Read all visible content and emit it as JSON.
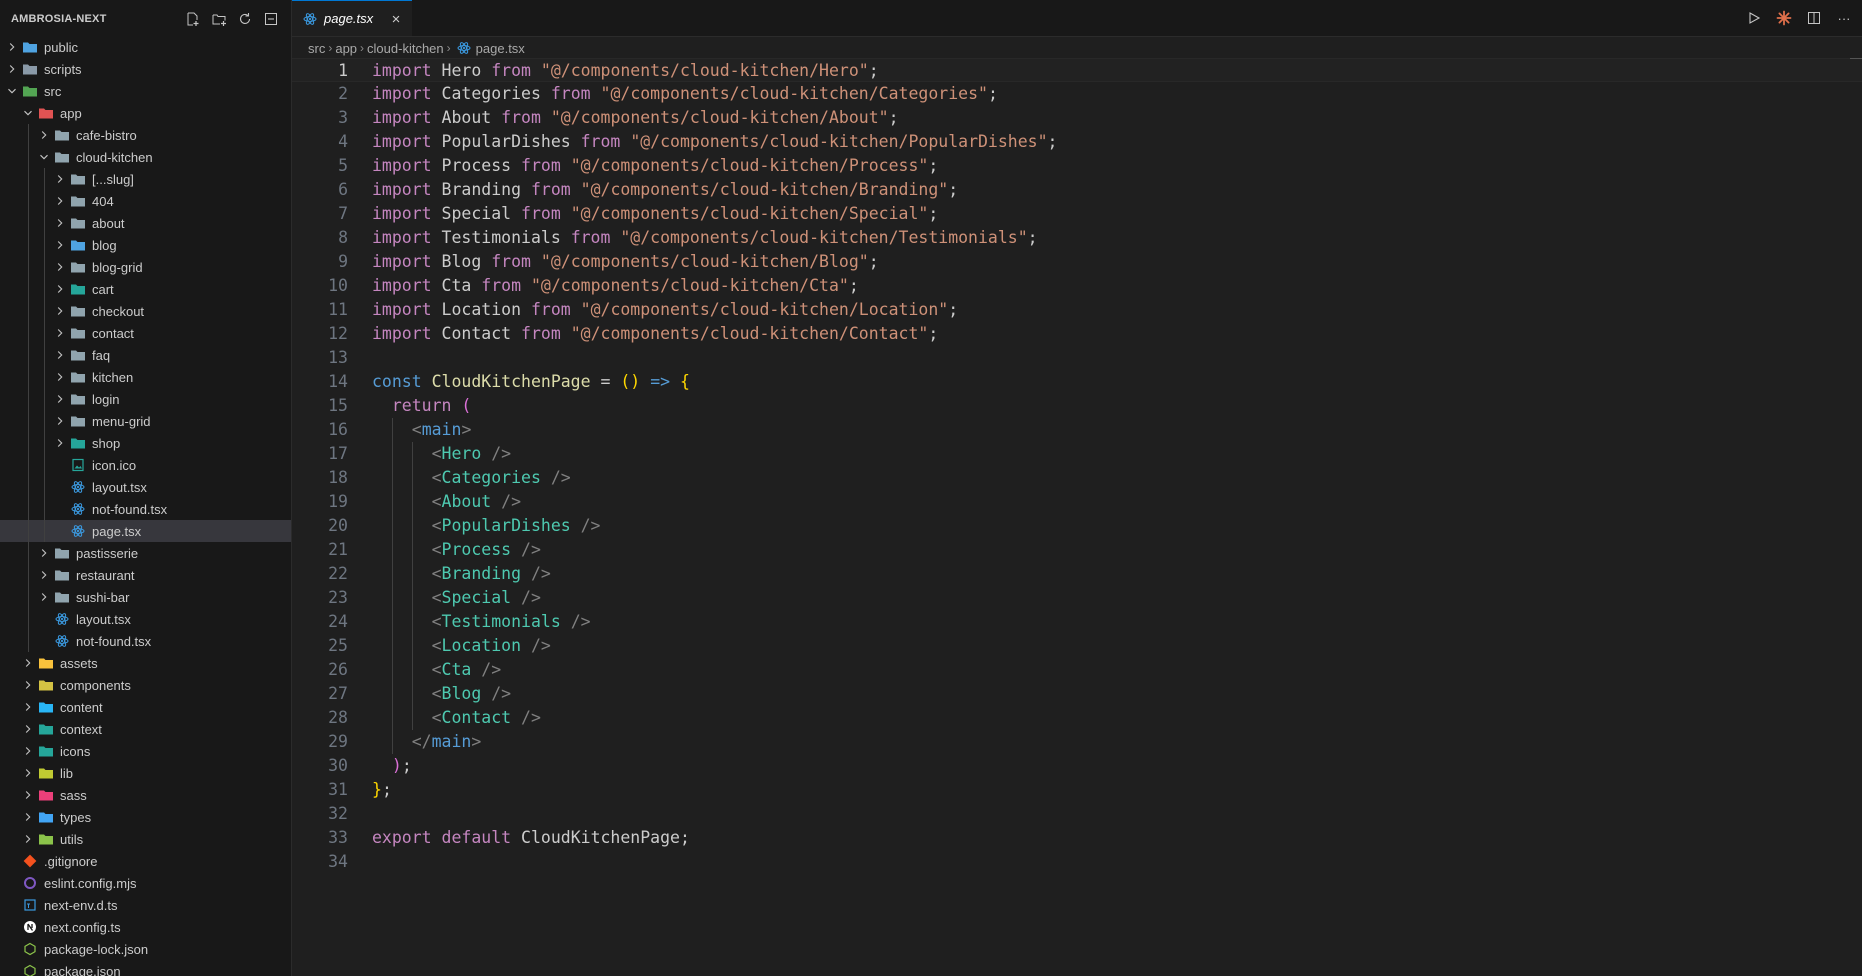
{
  "sidebar": {
    "title": "AMBROSIA-NEXT",
    "actions": [
      {
        "name": "new-file-icon"
      },
      {
        "name": "new-folder-icon"
      },
      {
        "name": "refresh-icon"
      },
      {
        "name": "collapse-all-icon"
      }
    ],
    "items": [
      {
        "label": "public",
        "depth": 0,
        "chevron": "closed",
        "icon": "folder-blue",
        "color": "#4fa3e0"
      },
      {
        "label": "scripts",
        "depth": 0,
        "chevron": "closed",
        "icon": "folder-grey",
        "color": "#8a9aa8"
      },
      {
        "label": "src",
        "depth": 0,
        "chevron": "open",
        "icon": "folder-green",
        "color": "#53a553"
      },
      {
        "label": "app",
        "depth": 1,
        "chevron": "open",
        "icon": "folder-red",
        "color": "#e05353"
      },
      {
        "label": "cafe-bistro",
        "depth": 2,
        "chevron": "closed",
        "icon": "folder-grey",
        "color": "#90a4ae"
      },
      {
        "label": "cloud-kitchen",
        "depth": 2,
        "chevron": "open",
        "icon": "folder-grey",
        "color": "#90a4ae"
      },
      {
        "label": "[...slug]",
        "depth": 3,
        "chevron": "closed",
        "icon": "folder-grey",
        "color": "#90a4ae"
      },
      {
        "label": "404",
        "depth": 3,
        "chevron": "closed",
        "icon": "folder-grey",
        "color": "#90a4ae"
      },
      {
        "label": "about",
        "depth": 3,
        "chevron": "closed",
        "icon": "folder-grey",
        "color": "#90a4ae"
      },
      {
        "label": "blog",
        "depth": 3,
        "chevron": "closed",
        "icon": "folder-blue",
        "color": "#4fa3e0"
      },
      {
        "label": "blog-grid",
        "depth": 3,
        "chevron": "closed",
        "icon": "folder-grey",
        "color": "#90a4ae"
      },
      {
        "label": "cart",
        "depth": 3,
        "chevron": "closed",
        "icon": "folder-teal",
        "color": "#26a69a"
      },
      {
        "label": "checkout",
        "depth": 3,
        "chevron": "closed",
        "icon": "folder-grey",
        "color": "#90a4ae"
      },
      {
        "label": "contact",
        "depth": 3,
        "chevron": "closed",
        "icon": "folder-grey",
        "color": "#90a4ae"
      },
      {
        "label": "faq",
        "depth": 3,
        "chevron": "closed",
        "icon": "folder-grey",
        "color": "#90a4ae"
      },
      {
        "label": "kitchen",
        "depth": 3,
        "chevron": "closed",
        "icon": "folder-grey",
        "color": "#90a4ae"
      },
      {
        "label": "login",
        "depth": 3,
        "chevron": "closed",
        "icon": "folder-grey",
        "color": "#90a4ae"
      },
      {
        "label": "menu-grid",
        "depth": 3,
        "chevron": "closed",
        "icon": "folder-grey",
        "color": "#90a4ae"
      },
      {
        "label": "shop",
        "depth": 3,
        "chevron": "closed",
        "icon": "folder-teal",
        "color": "#26a69a"
      },
      {
        "label": "icon.ico",
        "depth": 3,
        "chevron": "none",
        "icon": "file-image",
        "color": "#26a69a"
      },
      {
        "label": "layout.tsx",
        "depth": 3,
        "chevron": "none",
        "icon": "file-react",
        "color": "#3b9ae1"
      },
      {
        "label": "not-found.tsx",
        "depth": 3,
        "chevron": "none",
        "icon": "file-react",
        "color": "#3b9ae1"
      },
      {
        "label": "page.tsx",
        "depth": 3,
        "chevron": "none",
        "icon": "file-react",
        "color": "#3b9ae1",
        "selected": true
      },
      {
        "label": "pastisserie",
        "depth": 2,
        "chevron": "closed",
        "icon": "folder-grey",
        "color": "#90a4ae"
      },
      {
        "label": "restaurant",
        "depth": 2,
        "chevron": "closed",
        "icon": "folder-grey",
        "color": "#90a4ae"
      },
      {
        "label": "sushi-bar",
        "depth": 2,
        "chevron": "closed",
        "icon": "folder-grey",
        "color": "#90a4ae"
      },
      {
        "label": "layout.tsx",
        "depth": 2,
        "chevron": "none",
        "icon": "file-react",
        "color": "#3b9ae1"
      },
      {
        "label": "not-found.tsx",
        "depth": 2,
        "chevron": "none",
        "icon": "file-react",
        "color": "#3b9ae1"
      },
      {
        "label": "assets",
        "depth": 1,
        "chevron": "closed",
        "icon": "folder-yellow",
        "color": "#f9c23c"
      },
      {
        "label": "components",
        "depth": 1,
        "chevron": "closed",
        "icon": "folder-yellow",
        "color": "#d4c243"
      },
      {
        "label": "content",
        "depth": 1,
        "chevron": "closed",
        "icon": "folder-cyan",
        "color": "#29b6f6"
      },
      {
        "label": "context",
        "depth": 1,
        "chevron": "closed",
        "icon": "folder-teal",
        "color": "#26a69a"
      },
      {
        "label": "icons",
        "depth": 1,
        "chevron": "closed",
        "icon": "folder-teal",
        "color": "#26a69a"
      },
      {
        "label": "lib",
        "depth": 1,
        "chevron": "closed",
        "icon": "folder-yellow",
        "color": "#c0ca33"
      },
      {
        "label": "sass",
        "depth": 1,
        "chevron": "closed",
        "icon": "folder-pink",
        "color": "#ec407a"
      },
      {
        "label": "types",
        "depth": 1,
        "chevron": "closed",
        "icon": "folder-blue",
        "color": "#42a5f5"
      },
      {
        "label": "utils",
        "depth": 1,
        "chevron": "closed",
        "icon": "folder-green",
        "color": "#8bc34a"
      },
      {
        "label": ".gitignore",
        "depth": 0,
        "chevron": "none",
        "icon": "file-git",
        "color": "#f4511e"
      },
      {
        "label": "eslint.config.mjs",
        "depth": 0,
        "chevron": "none",
        "icon": "file-eslint",
        "color": "#7e57c2"
      },
      {
        "label": "next-env.d.ts",
        "depth": 0,
        "chevron": "none",
        "icon": "file-ts",
        "color": "#3b9ae1"
      },
      {
        "label": "next.config.ts",
        "depth": 0,
        "chevron": "none",
        "icon": "file-next",
        "color": "#ffffff"
      },
      {
        "label": "package-lock.json",
        "depth": 0,
        "chevron": "none",
        "icon": "file-npm",
        "color": "#8bc34a"
      },
      {
        "label": "package.json",
        "depth": 0,
        "chevron": "none",
        "icon": "file-npm",
        "color": "#8bc34a"
      }
    ]
  },
  "editor": {
    "tab": {
      "label": "page.tsx",
      "close": "×"
    },
    "breadcrumb": [
      "src",
      "app",
      "cloud-kitchen",
      "page.tsx"
    ],
    "top_actions": [
      {
        "name": "run-icon"
      },
      {
        "name": "claude-icon"
      },
      {
        "name": "split-editor-icon"
      },
      {
        "name": "more-actions-icon",
        "text": "···"
      }
    ],
    "current_line": 1,
    "code_lines": [
      [
        [
          "k",
          "import"
        ],
        [
          "p",
          " Hero "
        ],
        [
          "k",
          "from"
        ],
        [
          "p",
          " "
        ],
        [
          "s",
          "\"@/components/cloud-kitchen/Hero\""
        ],
        [
          "p",
          ";"
        ]
      ],
      [
        [
          "k",
          "import"
        ],
        [
          "p",
          " Categories "
        ],
        [
          "k",
          "from"
        ],
        [
          "p",
          " "
        ],
        [
          "s",
          "\"@/components/cloud-kitchen/Categories\""
        ],
        [
          "p",
          ";"
        ]
      ],
      [
        [
          "k",
          "import"
        ],
        [
          "p",
          " About "
        ],
        [
          "k",
          "from"
        ],
        [
          "p",
          " "
        ],
        [
          "s",
          "\"@/components/cloud-kitchen/About\""
        ],
        [
          "p",
          ";"
        ]
      ],
      [
        [
          "k",
          "import"
        ],
        [
          "p",
          " PopularDishes "
        ],
        [
          "k",
          "from"
        ],
        [
          "p",
          " "
        ],
        [
          "s",
          "\"@/components/cloud-kitchen/PopularDishes\""
        ],
        [
          "p",
          ";"
        ]
      ],
      [
        [
          "k",
          "import"
        ],
        [
          "p",
          " Process "
        ],
        [
          "k",
          "from"
        ],
        [
          "p",
          " "
        ],
        [
          "s",
          "\"@/components/cloud-kitchen/Process\""
        ],
        [
          "p",
          ";"
        ]
      ],
      [
        [
          "k",
          "import"
        ],
        [
          "p",
          " Branding "
        ],
        [
          "k",
          "from"
        ],
        [
          "p",
          " "
        ],
        [
          "s",
          "\"@/components/cloud-kitchen/Branding\""
        ],
        [
          "p",
          ";"
        ]
      ],
      [
        [
          "k",
          "import"
        ],
        [
          "p",
          " Special "
        ],
        [
          "k",
          "from"
        ],
        [
          "p",
          " "
        ],
        [
          "s",
          "\"@/components/cloud-kitchen/Special\""
        ],
        [
          "p",
          ";"
        ]
      ],
      [
        [
          "k",
          "import"
        ],
        [
          "p",
          " Testimonials "
        ],
        [
          "k",
          "from"
        ],
        [
          "p",
          " "
        ],
        [
          "s",
          "\"@/components/cloud-kitchen/Testimonials\""
        ],
        [
          "p",
          ";"
        ]
      ],
      [
        [
          "k",
          "import"
        ],
        [
          "p",
          " Blog "
        ],
        [
          "k",
          "from"
        ],
        [
          "p",
          " "
        ],
        [
          "s",
          "\"@/components/cloud-kitchen/Blog\""
        ],
        [
          "p",
          ";"
        ]
      ],
      [
        [
          "k",
          "import"
        ],
        [
          "p",
          " Cta "
        ],
        [
          "k",
          "from"
        ],
        [
          "p",
          " "
        ],
        [
          "s",
          "\"@/components/cloud-kitchen/Cta\""
        ],
        [
          "p",
          ";"
        ]
      ],
      [
        [
          "k",
          "import"
        ],
        [
          "p",
          " Location "
        ],
        [
          "k",
          "from"
        ],
        [
          "p",
          " "
        ],
        [
          "s",
          "\"@/components/cloud-kitchen/Location\""
        ],
        [
          "p",
          ";"
        ]
      ],
      [
        [
          "k",
          "import"
        ],
        [
          "p",
          " Contact "
        ],
        [
          "k",
          "from"
        ],
        [
          "p",
          " "
        ],
        [
          "s",
          "\"@/components/cloud-kitchen/Contact\""
        ],
        [
          "p",
          ";"
        ]
      ],
      [],
      [
        [
          "d",
          "const"
        ],
        [
          "p",
          " "
        ],
        [
          "v",
          "CloudKitchenPage"
        ],
        [
          "p",
          " = "
        ],
        [
          "y",
          "()"
        ],
        [
          "p",
          " "
        ],
        [
          "d",
          "=>"
        ],
        [
          "p",
          " "
        ],
        [
          "y",
          "{"
        ]
      ],
      [
        [
          "p",
          "  "
        ],
        [
          "k",
          "return"
        ],
        [
          "p",
          " "
        ],
        [
          "m",
          "("
        ]
      ],
      [
        [
          "p",
          "    "
        ],
        [
          "g",
          "<"
        ],
        [
          "d",
          "main"
        ],
        [
          "g",
          ">"
        ]
      ],
      [
        [
          "p",
          "      "
        ],
        [
          "g",
          "<"
        ],
        [
          "t",
          "Hero"
        ],
        [
          "p",
          " "
        ],
        [
          "g",
          "/>"
        ]
      ],
      [
        [
          "p",
          "      "
        ],
        [
          "g",
          "<"
        ],
        [
          "t",
          "Categories"
        ],
        [
          "p",
          " "
        ],
        [
          "g",
          "/>"
        ]
      ],
      [
        [
          "p",
          "      "
        ],
        [
          "g",
          "<"
        ],
        [
          "t",
          "About"
        ],
        [
          "p",
          " "
        ],
        [
          "g",
          "/>"
        ]
      ],
      [
        [
          "p",
          "      "
        ],
        [
          "g",
          "<"
        ],
        [
          "t",
          "PopularDishes"
        ],
        [
          "p",
          " "
        ],
        [
          "g",
          "/>"
        ]
      ],
      [
        [
          "p",
          "      "
        ],
        [
          "g",
          "<"
        ],
        [
          "t",
          "Process"
        ],
        [
          "p",
          " "
        ],
        [
          "g",
          "/>"
        ]
      ],
      [
        [
          "p",
          "      "
        ],
        [
          "g",
          "<"
        ],
        [
          "t",
          "Branding"
        ],
        [
          "p",
          " "
        ],
        [
          "g",
          "/>"
        ]
      ],
      [
        [
          "p",
          "      "
        ],
        [
          "g",
          "<"
        ],
        [
          "t",
          "Special"
        ],
        [
          "p",
          " "
        ],
        [
          "g",
          "/>"
        ]
      ],
      [
        [
          "p",
          "      "
        ],
        [
          "g",
          "<"
        ],
        [
          "t",
          "Testimonials"
        ],
        [
          "p",
          " "
        ],
        [
          "g",
          "/>"
        ]
      ],
      [
        [
          "p",
          "      "
        ],
        [
          "g",
          "<"
        ],
        [
          "t",
          "Location"
        ],
        [
          "p",
          " "
        ],
        [
          "g",
          "/>"
        ]
      ],
      [
        [
          "p",
          "      "
        ],
        [
          "g",
          "<"
        ],
        [
          "t",
          "Cta"
        ],
        [
          "p",
          " "
        ],
        [
          "g",
          "/>"
        ]
      ],
      [
        [
          "p",
          "      "
        ],
        [
          "g",
          "<"
        ],
        [
          "t",
          "Blog"
        ],
        [
          "p",
          " "
        ],
        [
          "g",
          "/>"
        ]
      ],
      [
        [
          "p",
          "      "
        ],
        [
          "g",
          "<"
        ],
        [
          "t",
          "Contact"
        ],
        [
          "p",
          " "
        ],
        [
          "g",
          "/>"
        ]
      ],
      [
        [
          "p",
          "    "
        ],
        [
          "g",
          "</"
        ],
        [
          "d",
          "main"
        ],
        [
          "g",
          ">"
        ]
      ],
      [
        [
          "p",
          "  "
        ],
        [
          "m",
          ")"
        ],
        [
          "p",
          ";"
        ]
      ],
      [
        [
          "y",
          "}"
        ],
        [
          "p",
          ";"
        ]
      ],
      [],
      [
        [
          "k",
          "export"
        ],
        [
          "p",
          " "
        ],
        [
          "k",
          "default"
        ],
        [
          "p",
          " CloudKitchenPage;"
        ]
      ],
      []
    ]
  }
}
